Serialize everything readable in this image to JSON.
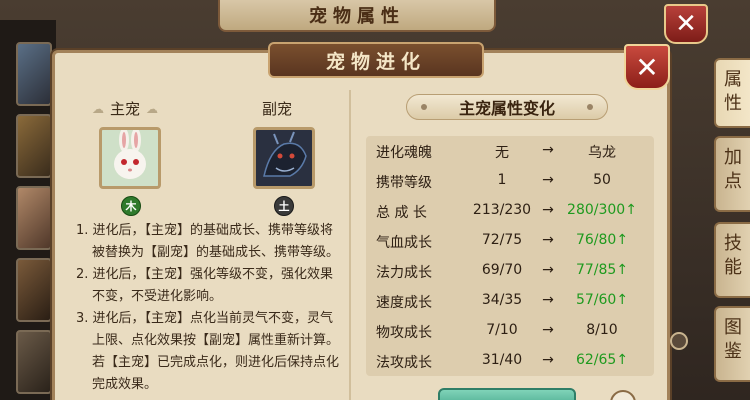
{
  "background": {
    "title": "宠物属性",
    "side_tabs": [
      "属性",
      "加点",
      "技能",
      "图鉴"
    ]
  },
  "dialog": {
    "title": "宠物进化",
    "close_icon": "close-x-icon",
    "main_pet": {
      "label": "主宠",
      "element": "木",
      "element_color": "#2f7a2c"
    },
    "sub_pet": {
      "label": "副宠",
      "element": "土",
      "element_color": "#3a3a3a"
    },
    "rules": [
      "1. 进化后，【主宠】的基础成长、携带等级将被替换为【副宠】的基础成长、携带等级。",
      "2. 进化后，【主宠】强化等级不变，强化效果不变，不受进化影响。",
      "3. 进化后，【主宠】点化当前灵气不变，灵气上限、点化效果按【副宠】属性重新计算。",
      "若【主宠】已完成点化，则进化后保持点化完成效果。"
    ],
    "attr_header": "主宠属性变化",
    "arrow": "→",
    "up_icon": "↑",
    "up_color": "#1f9a1f",
    "attributes": [
      {
        "name": "进化魂魄",
        "from": "无",
        "to": "乌龙",
        "up": ""
      },
      {
        "name": "携带等级",
        "from": "1",
        "to": "50",
        "up": ""
      },
      {
        "name": "总 成 长",
        "from": "213/230",
        "to": "280/300",
        "up": "↑"
      },
      {
        "name": "气血成长",
        "from": "72/75",
        "to": "76/80",
        "up": "↑"
      },
      {
        "name": "法力成长",
        "from": "69/70",
        "to": "77/85",
        "up": "↑"
      },
      {
        "name": "速度成长",
        "from": "34/35",
        "to": "57/60",
        "up": "↑"
      },
      {
        "name": "物攻成长",
        "from": "7/10",
        "to": "8/10",
        "up": ""
      },
      {
        "name": "法攻成长",
        "from": "31/40",
        "to": "62/65",
        "up": "↑"
      }
    ]
  }
}
